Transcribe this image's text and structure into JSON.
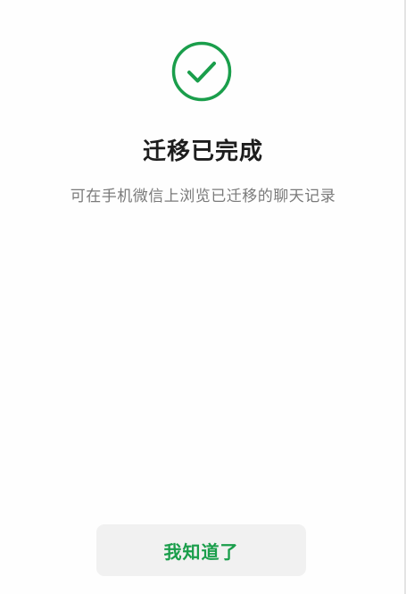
{
  "status": {
    "icon": "check-circle-icon",
    "title": "迁移已完成",
    "subtitle": "可在手机微信上浏览已迁移的聊天记录"
  },
  "actions": {
    "confirm_label": "我知道了"
  },
  "colors": {
    "accent": "#1a9e4b",
    "title": "#1d1d1d",
    "subtitle": "#7a7a7a",
    "button_bg": "#f1f1f1"
  }
}
